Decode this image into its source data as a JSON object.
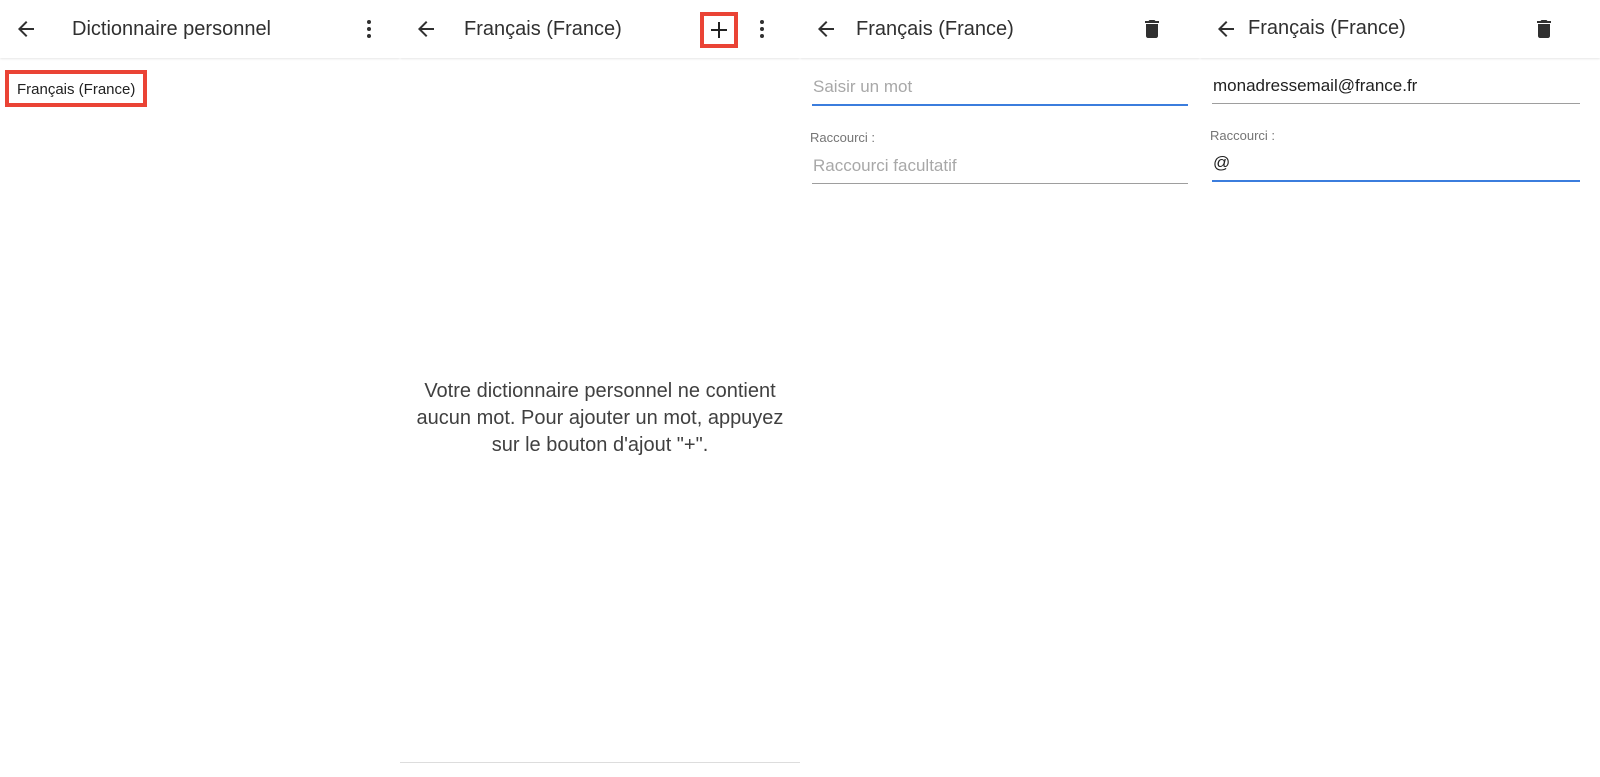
{
  "screens": [
    {
      "title": "Dictionnaire personnel",
      "items": [
        "Français (France)"
      ]
    },
    {
      "title": "Français (France)",
      "add_label": "+",
      "empty_message": "Votre dictionnaire personnel ne contient aucun mot. Pour ajouter un mot, appuyez sur le bouton d'ajout \"+\"."
    },
    {
      "title": "Français (France)",
      "word_value": "",
      "word_placeholder": "Saisir un mot",
      "shortcut_label": "Raccourci :",
      "shortcut_value": "",
      "shortcut_placeholder": "Raccourci facultatif"
    },
    {
      "title": "Français (France)",
      "word_value": "monadressemail@france.fr",
      "shortcut_label": "Raccourci :",
      "shortcut_value": "@"
    }
  ],
  "icons": {
    "back": "arrow-back-icon",
    "overflow": "more-vert-icon",
    "add": "plus-icon",
    "delete": "trash-icon"
  },
  "colors": {
    "highlight": "#ea4335",
    "focus_underline": "#3b7ddd",
    "icon": "#303030"
  }
}
